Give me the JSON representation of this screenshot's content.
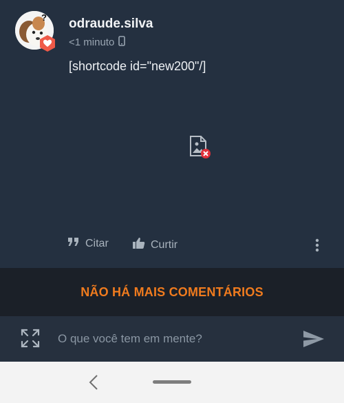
{
  "post": {
    "username": "odraude.silva",
    "time": "<1 minuto",
    "content": "[shortcode id=\"new200\"/]",
    "actions": {
      "quote_label": "Citar",
      "like_label": "Curtir"
    }
  },
  "feed": {
    "end_message": "NÃO HÁ MAIS COMENTÁRIOS"
  },
  "composer": {
    "placeholder": "O que você tem em mente?"
  },
  "colors": {
    "accent": "#f07b1e",
    "background": "#243040",
    "badge": "#ef5a48"
  }
}
